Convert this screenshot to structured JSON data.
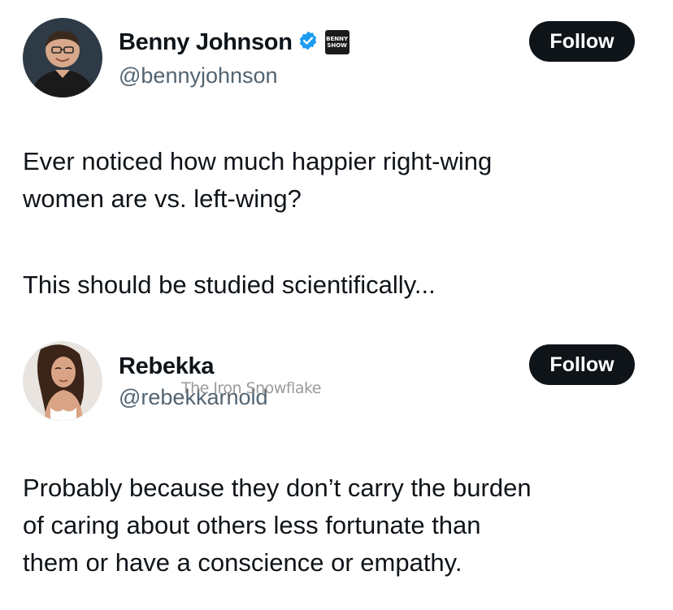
{
  "tweet1": {
    "display_name": "Benny Johnson",
    "handle": "@bennyjohnson",
    "affiliate_badge": "BENNY SHOW",
    "follow_label": "Follow",
    "text_lines": [
      "Ever noticed how much happier right-wing",
      "women are vs. left-wing?"
    ],
    "text_para2": "This should be studied scientifically..."
  },
  "tweet2": {
    "display_name": "Rebekka",
    "handle": "@rebekkarnold",
    "follow_label": "Follow",
    "text_lines": [
      "Probably because they don’t carry the burden",
      "of caring about others less fortunate than",
      "them or have a conscience or empathy."
    ]
  },
  "watermark": "The Iron Snowflake",
  "icons": {
    "verified": "verified-badge-icon",
    "affiliate": "affiliate-badge-icon"
  },
  "colors": {
    "verified_blue": "#1d9bf0",
    "button_bg": "#0f1419",
    "handle_gray": "#536471"
  }
}
